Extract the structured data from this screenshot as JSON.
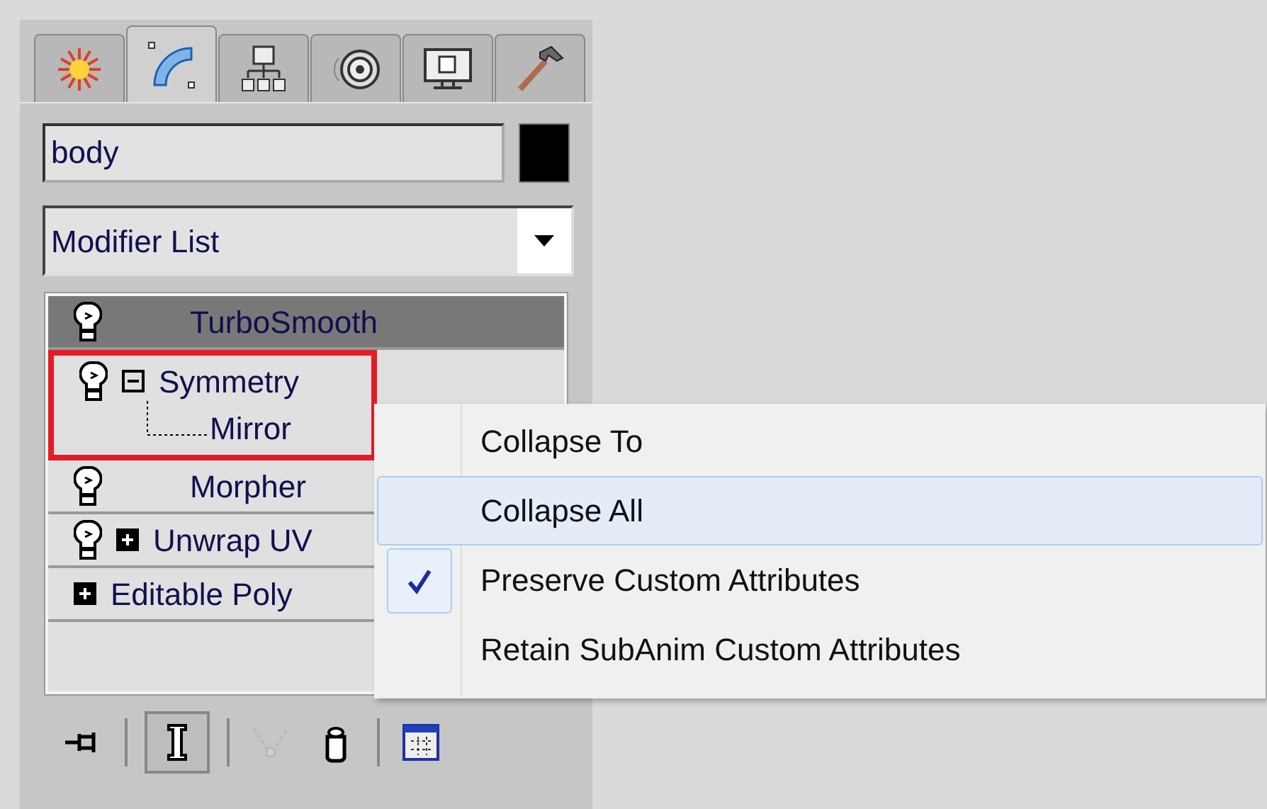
{
  "tabs": [
    {
      "selected": false
    },
    {
      "selected": true
    },
    {
      "selected": false
    },
    {
      "selected": false
    },
    {
      "selected": false
    },
    {
      "selected": false
    }
  ],
  "name_field": {
    "value": "body"
  },
  "modifier_dropdown": {
    "value": "Modifier List"
  },
  "stack": [
    {
      "name": "TurboSmooth",
      "kind": "modifier",
      "selected": true,
      "outlined": false,
      "expandable": false
    },
    {
      "name": "Symmetry",
      "kind": "modifier",
      "selected": false,
      "outlined": true,
      "expandable": true,
      "expanded": true,
      "children": [
        {
          "name": "Mirror"
        }
      ]
    },
    {
      "name": "Morpher",
      "kind": "modifier",
      "selected": false,
      "outlined": false,
      "expandable": false
    },
    {
      "name": "Unwrap UV",
      "kind": "modifier",
      "selected": false,
      "outlined": false,
      "expandable": true,
      "expanded": false
    },
    {
      "name": "Editable Poly",
      "kind": "base",
      "selected": false,
      "outlined": false,
      "expandable": true,
      "expanded": false
    }
  ],
  "toolbar": [
    {
      "pressed": false,
      "disabled": false
    },
    {
      "pressed": true,
      "disabled": false
    },
    {
      "pressed": false,
      "disabled": true
    },
    {
      "pressed": false,
      "disabled": false
    },
    {
      "pressed": false,
      "disabled": false
    }
  ],
  "context_menu": [
    {
      "label": "Collapse To",
      "highlighted": false,
      "checked": false
    },
    {
      "label": "Collapse All",
      "highlighted": true,
      "checked": false
    },
    {
      "label": "Preserve Custom Attributes",
      "highlighted": false,
      "checked": true
    },
    {
      "label": "Retain SubAnim Custom Attributes",
      "highlighted": false,
      "checked": false
    }
  ]
}
